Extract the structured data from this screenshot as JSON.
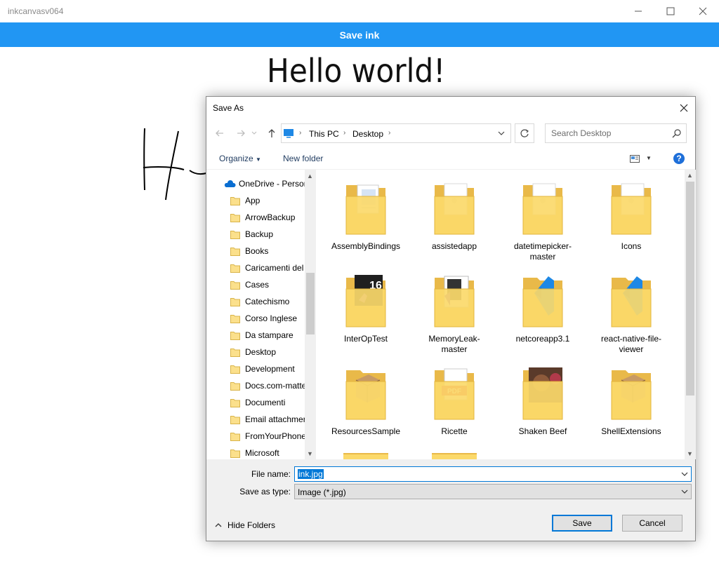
{
  "window": {
    "title": "inkcanvasv064"
  },
  "app": {
    "save_ink_label": "Save ink",
    "heading": "Hello world!"
  },
  "dialog": {
    "title": "Save As",
    "breadcrumb": [
      "This PC",
      "Desktop"
    ],
    "search_placeholder": "Search Desktop",
    "toolbar": {
      "organize_label": "Organize",
      "new_folder_label": "New folder"
    },
    "tree": [
      {
        "label": "OneDrive - Person",
        "icon": "onedrive-icon"
      },
      {
        "label": "App",
        "icon": "folder-icon"
      },
      {
        "label": "ArrowBackup",
        "icon": "folder-icon"
      },
      {
        "label": "Backup",
        "icon": "folder-icon"
      },
      {
        "label": "Books",
        "icon": "folder-icon"
      },
      {
        "label": "Caricamenti del",
        "icon": "folder-icon"
      },
      {
        "label": "Cases",
        "icon": "folder-icon"
      },
      {
        "label": "Catechismo",
        "icon": "folder-icon"
      },
      {
        "label": "Corso Inglese",
        "icon": "folder-icon"
      },
      {
        "label": "Da stampare",
        "icon": "folder-icon"
      },
      {
        "label": "Desktop",
        "icon": "folder-icon"
      },
      {
        "label": "Development",
        "icon": "folder-icon"
      },
      {
        "label": "Docs.com-matte",
        "icon": "folder-icon"
      },
      {
        "label": "Documenti",
        "icon": "folder-icon"
      },
      {
        "label": "Email attachmer",
        "icon": "folder-icon"
      },
      {
        "label": "FromYourPhone",
        "icon": "folder-icon"
      },
      {
        "label": "Microsoft",
        "icon": "folder-icon"
      }
    ],
    "files": [
      {
        "label": "AssemblyBindings",
        "icon": "folder-docs-icon"
      },
      {
        "label": "assistedapp",
        "icon": "folder-file-icon"
      },
      {
        "label": "datetimepicker-master",
        "icon": "folder-file-icon"
      },
      {
        "label": "Icons",
        "icon": "folder-file-icon"
      },
      {
        "label": "InterOpTest",
        "icon": "folder-vs16-icon"
      },
      {
        "label": "MemoryLeak-master",
        "icon": "folder-vs-icon"
      },
      {
        "label": "netcoreapp3.1",
        "icon": "folder-vscode-icon"
      },
      {
        "label": "react-native-file-viewer",
        "icon": "folder-vscode-icon"
      },
      {
        "label": "ResourcesSample",
        "icon": "folder-box-icon"
      },
      {
        "label": "Ricette",
        "icon": "folder-pdf-icon"
      },
      {
        "label": "Shaken Beef",
        "icon": "folder-photo-icon"
      },
      {
        "label": "ShellExtensions",
        "icon": "folder-box-icon"
      }
    ],
    "form": {
      "file_name_label": "File name:",
      "file_name_value": "ink.jpg",
      "save_type_label": "Save as type:",
      "save_type_value": "Image (*.jpg)"
    },
    "footer": {
      "hide_folders_label": "Hide Folders",
      "save_label": "Save",
      "cancel_label": "Cancel"
    }
  },
  "colors": {
    "accent": "#2196f3",
    "selection": "#0078d7",
    "folder": "#f8d775"
  }
}
